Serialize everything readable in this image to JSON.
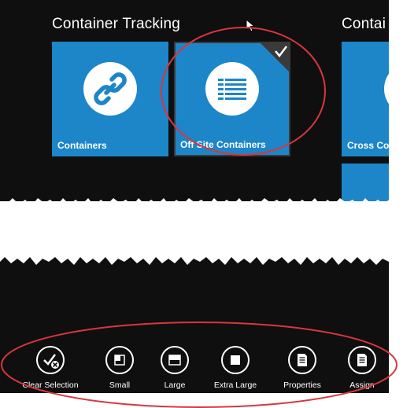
{
  "start_screen": {
    "groups": [
      {
        "title": "Container Tracking"
      },
      {
        "title": "Contai"
      }
    ],
    "tiles": [
      {
        "label": "Containers",
        "icon": "link-icon",
        "selected": false
      },
      {
        "label": "Off Site Containers",
        "icon": "table-list-icon",
        "selected": true
      },
      {
        "label": "Cross Co",
        "icon": "document-icon",
        "selected": false
      }
    ]
  },
  "app_bar": {
    "buttons": [
      {
        "label": "Clear Selection",
        "icon": "clear-selection-icon"
      },
      {
        "label": "Small",
        "icon": "tile-small-icon"
      },
      {
        "label": "Large",
        "icon": "tile-large-icon"
      },
      {
        "label": "Extra Large",
        "icon": "tile-extra-large-icon"
      },
      {
        "label": "Properties",
        "icon": "properties-icon"
      },
      {
        "label": "Assign",
        "icon": "assign-icon"
      }
    ]
  },
  "colors": {
    "background": "#0f0f0f",
    "tile": "#1c86c9",
    "selected_tile": "#1c86c9",
    "annotation": "#d9363e"
  }
}
